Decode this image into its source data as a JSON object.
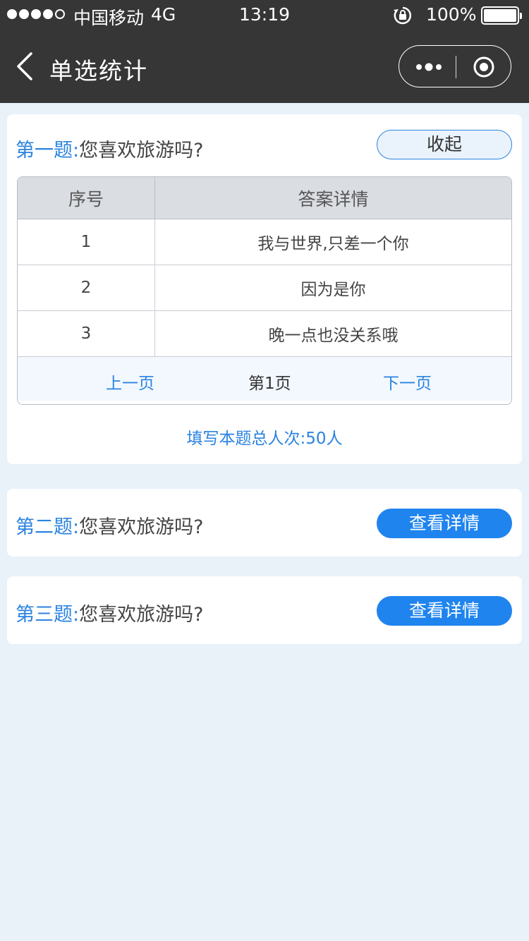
{
  "status_bar": {
    "carrier": "中国移动",
    "network": "4G",
    "time": "13:19",
    "battery": "100%"
  },
  "nav": {
    "title": "单选统计"
  },
  "questions": [
    {
      "number": "第一题:",
      "text": "您喜欢旅游吗?",
      "button": "收起",
      "table": {
        "headers": [
          "序号",
          "答案详情"
        ],
        "rows": [
          {
            "index": "1",
            "answer": "我与世界,只差一个你"
          },
          {
            "index": "2",
            "answer": "因为是你"
          },
          {
            "index": "3",
            "answer": "晚一点也没关系哦"
          }
        ],
        "pager": {
          "prev": "上一页",
          "current": "第1页",
          "next": "下一页"
        }
      },
      "total": "填写本题总人次:50人"
    },
    {
      "number": "第二题:",
      "text": "您喜欢旅游吗?",
      "button": "查看详情"
    },
    {
      "number": "第三题:",
      "text": "您喜欢旅游吗?",
      "button": "查看详情"
    }
  ],
  "colors": {
    "header_bg": "#363636",
    "page_bg": "#e9f1f9",
    "accent": "#1f84ee",
    "question_number": "#2b83e0"
  }
}
